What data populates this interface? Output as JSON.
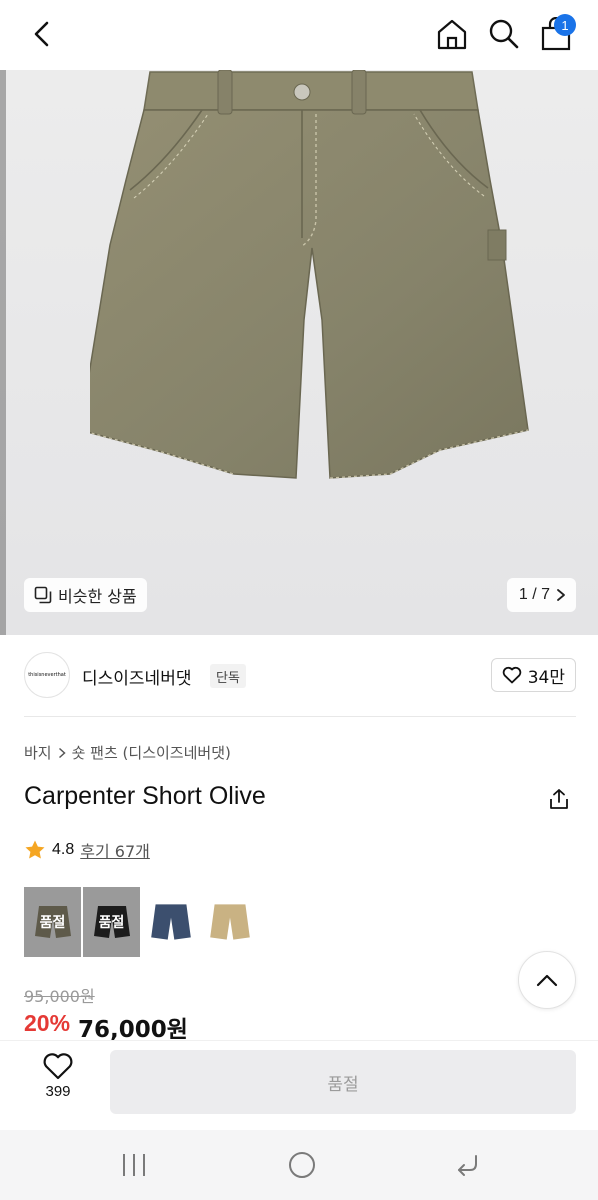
{
  "topbar": {
    "cart_count": "1"
  },
  "gallery": {
    "similar_label": "비슷한 상품",
    "counter": "1 / 7"
  },
  "brand": {
    "logo_text": "thisisneverthat",
    "name": "디스이즈네버댓",
    "tag": "단독",
    "likes": "34만"
  },
  "breadcrumb": {
    "category": "바지",
    "subcategory": "숏 팬츠 (디스이즈네버댓)"
  },
  "product": {
    "title": "Carpenter Short Olive",
    "rating": "4.8",
    "reviews": "후기 67개"
  },
  "swatches": [
    {
      "color": "#5e5a4a",
      "sold_label": "품절"
    },
    {
      "color": "#1c1c1c",
      "sold_label": "품절"
    },
    {
      "color": "#3c4f6e",
      "sold_label": ""
    },
    {
      "color": "#c9b283",
      "sold_label": ""
    }
  ],
  "price": {
    "original": "95,000원",
    "discount": "20%",
    "sale": "76,000원"
  },
  "bottom": {
    "wish_count": "399",
    "cta_label": "품절"
  },
  "colors": {
    "accent_blue": "#1a73e8",
    "discount_red": "#e53935",
    "star": "#f5a623",
    "shorts": "#8c8a6c"
  }
}
